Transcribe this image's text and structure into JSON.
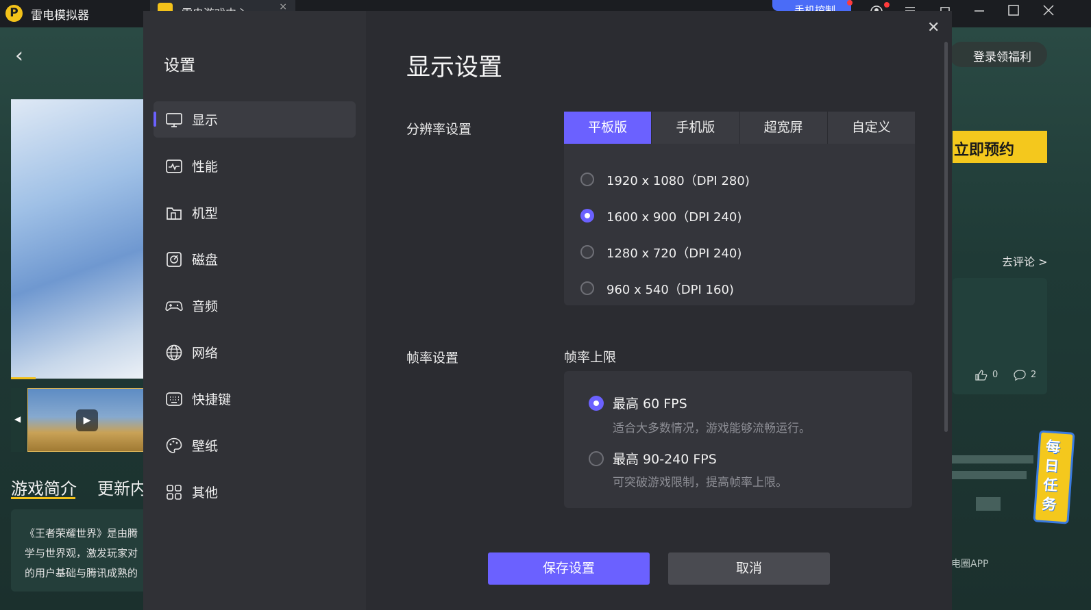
{
  "titlebar": {
    "app_name": "雷电模拟器",
    "tab_label": "雷电游戏中心",
    "tab_close": "×",
    "phone_control": "手机控制"
  },
  "background": {
    "back_arrow": "‹",
    "login_button": "登录领福利",
    "reserve_button": "立即预约",
    "comment_link": "去评论 >",
    "like_count": "0",
    "reply_count": "2",
    "intro_tabs": [
      "游戏简介",
      "更新内容"
    ],
    "intro_text": [
      "《王者荣耀世界》是由腾",
      "学与世界观，激发玩家对",
      "的用户基础与腾讯成熟的"
    ],
    "daily_task": "每日任务",
    "app_promo": "电圈APP"
  },
  "dialog": {
    "sidebar_title": "设置",
    "nav": [
      {
        "label": "显示",
        "icon": "monitor-icon",
        "active": true
      },
      {
        "label": "性能",
        "icon": "performance-icon",
        "active": false
      },
      {
        "label": "机型",
        "icon": "device-model-icon",
        "active": false
      },
      {
        "label": "磁盘",
        "icon": "disk-icon",
        "active": false
      },
      {
        "label": "音频",
        "icon": "gamepad-icon",
        "active": false
      },
      {
        "label": "网络",
        "icon": "globe-icon",
        "active": false
      },
      {
        "label": "快捷键",
        "icon": "keyboard-icon",
        "active": false
      },
      {
        "label": "壁纸",
        "icon": "palette-icon",
        "active": false
      },
      {
        "label": "其他",
        "icon": "grid-icon",
        "active": false
      }
    ],
    "title": "显示设置",
    "close": "✕",
    "resolution": {
      "label": "分辨率设置",
      "tabs": [
        "平板版",
        "手机版",
        "超宽屏",
        "自定义"
      ],
      "active_tab": "平板版",
      "options": [
        {
          "text": "1920 x 1080（DPI 280)",
          "checked": false
        },
        {
          "text": "1600 x 900（DPI 240)",
          "checked": true
        },
        {
          "text": "1280 x 720（DPI 240)",
          "checked": false
        },
        {
          "text": "960 x 540（DPI 160)",
          "checked": false
        }
      ]
    },
    "fps": {
      "label": "帧率设置",
      "sub_label": "帧率上限",
      "options": [
        {
          "title": "最高 60 FPS",
          "desc": "适合大多数情况，游戏能够流畅运行。",
          "checked": true
        },
        {
          "title": "最高 90-240 FPS",
          "desc": "可突破游戏限制，提高帧率上限。",
          "checked": false
        }
      ]
    },
    "save_button": "保存设置",
    "cancel_button": "取消"
  },
  "colors": {
    "accent": "#6b61ff",
    "brand_yellow": "#f4c81d",
    "dialog_bg": "#2b2c31",
    "sidebar_bg": "#303136"
  }
}
